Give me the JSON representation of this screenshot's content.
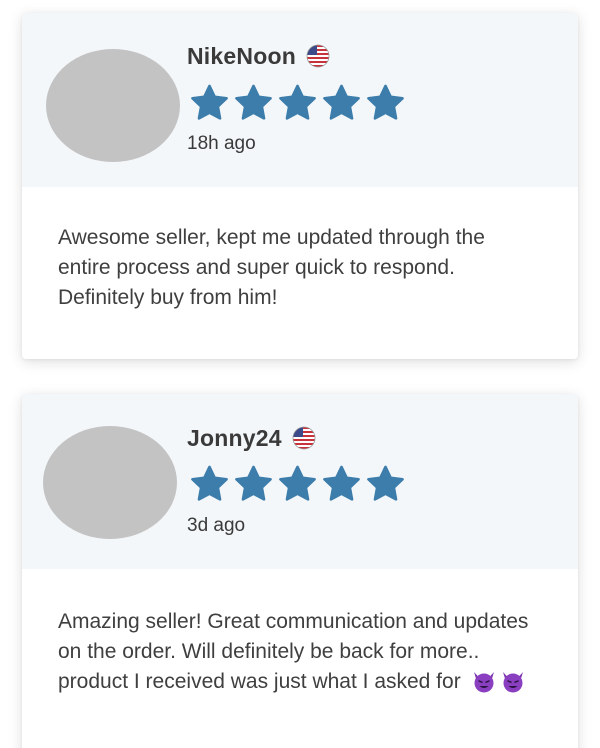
{
  "reviews": [
    {
      "username": "NikeNoon",
      "country_flag": "us-flag-icon",
      "rating": 5,
      "max_rating": 5,
      "time": "18h ago",
      "text": "Awesome seller, kept me updated through the entire process and super quick to respond. Definitely buy from him!"
    },
    {
      "username": "Jonny24",
      "country_flag": "us-flag-icon",
      "rating": 5,
      "max_rating": 5,
      "time": "3d ago",
      "text": "Amazing seller! Great communication and updates on the order. Will definitely be back for more.. product I received was just what I asked for",
      "emojis": [
        "smiling-devil-emoji",
        "smiling-devil-emoji"
      ]
    }
  ],
  "colors": {
    "star": "#3d7dab",
    "header_bg": "#f3f7f9",
    "avatar": "#c3c3c3",
    "text": "#3f3f3f",
    "devil": "#8a3fc1"
  }
}
